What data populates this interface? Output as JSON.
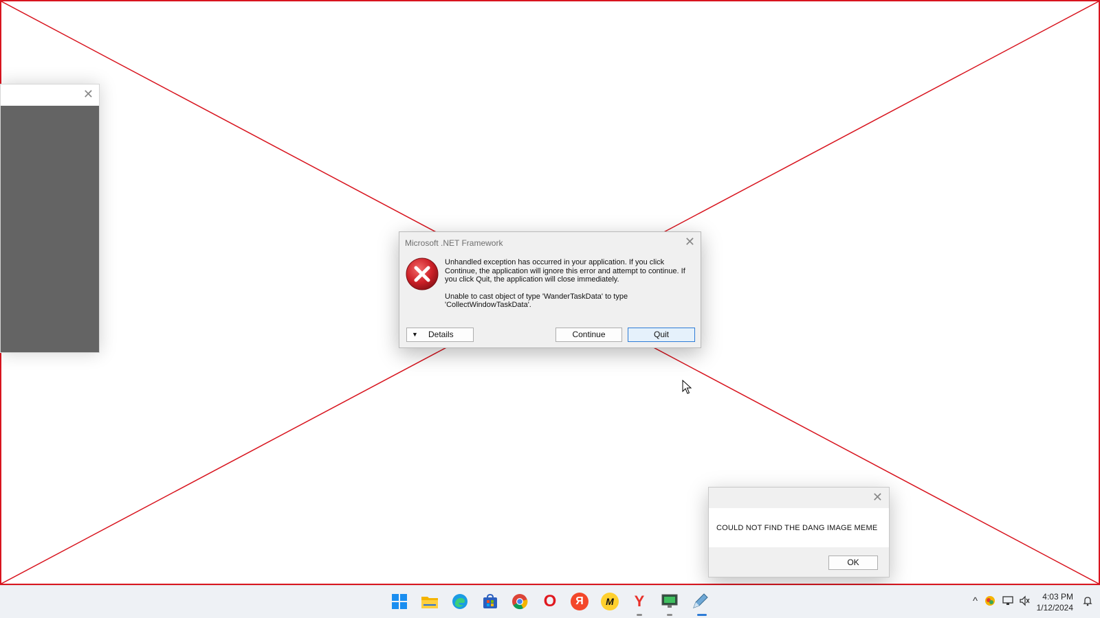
{
  "net_dialog": {
    "title": "Microsoft .NET Framework",
    "message_1": "Unhandled exception has occurred in your application. If you click Continue, the application will ignore this error and attempt to continue. If you click Quit, the application will close immediately.",
    "message_2": "Unable to cast object of type 'WanderTaskData' to type 'CollectWindowTaskData'.",
    "details_label": "Details",
    "continue_label": "Continue",
    "quit_label": "Quit",
    "close_glyph": "✕"
  },
  "left_window": {
    "close_glyph": "✕"
  },
  "message_box": {
    "text": "COULD NOT FIND THE DANG IMAGE MEME",
    "ok_label": "OK",
    "close_glyph": "✕"
  },
  "taskbar": {
    "apps": [
      {
        "icon": "windows-start-icon",
        "glyph": ""
      },
      {
        "icon": "file-explorer-icon",
        "glyph": ""
      },
      {
        "icon": "edge-browser-icon",
        "glyph": ""
      },
      {
        "icon": "microsoft-store-icon",
        "glyph": ""
      },
      {
        "icon": "chrome-browser-icon",
        "glyph": ""
      },
      {
        "icon": "opera-browser-icon",
        "glyph": "O"
      },
      {
        "icon": "yandex-icon",
        "glyph": "Я"
      },
      {
        "icon": "miro-app-icon",
        "glyph": "M"
      },
      {
        "icon": "yandex-browser-icon",
        "glyph": "Y"
      },
      {
        "icon": "network-app-icon",
        "glyph": ""
      },
      {
        "icon": "pen-app-icon",
        "glyph": ""
      }
    ],
    "tray": {
      "chevron": "^",
      "time": "4:03 PM",
      "date": "1/12/2024"
    }
  },
  "colors": {
    "frame_red": "#d8141e",
    "error_red": "#cc2027",
    "accent_blue": "#2d7bd6"
  }
}
